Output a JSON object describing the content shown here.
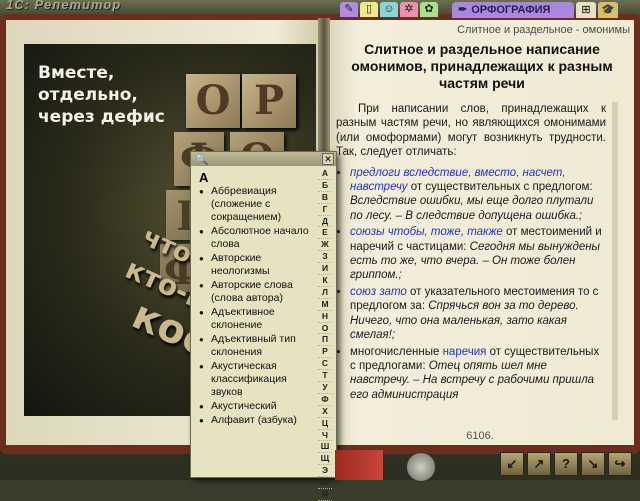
{
  "app": {
    "title": "1C: Репетитор"
  },
  "tabs": {
    "icons": [
      {
        "icon": "book-icon",
        "glyph": "✎",
        "color": "#b28be0"
      },
      {
        "icon": "notebook-icon",
        "glyph": "▯",
        "color": "#f0ea8c"
      },
      {
        "icon": "people-icon",
        "glyph": "☺",
        "color": "#8bd4d8"
      },
      {
        "icon": "sun-icon",
        "glyph": "✲",
        "color": "#f28fb0"
      },
      {
        "icon": "flower-icon",
        "glyph": "✿",
        "color": "#a7e08a"
      }
    ],
    "active_label": "ОРФОГРАФИЯ",
    "end_icon_1": "⊞",
    "end_icon_2": "🎓"
  },
  "cover": {
    "slogan": "Вместе,\nотдельно,\nчерез дефис",
    "blocks": [
      "О",
      "Р",
      "Ф",
      "О",
      "Г",
      "Ф"
    ],
    "slant_lines": [
      "что-либо",
      "кто-нибудь",
      "кое-кто"
    ]
  },
  "right_page": {
    "running_head": "Слитное и раздельное - омонимы",
    "title": "Слитное и раздельное написание омонимов, принадлежащих к разным частям речи",
    "intro": "При написании слов, принадлежащих к разным частям речи, но являющихся омонимами (или омоформами) могут возникнуть трудности. Так, следует отличать:",
    "items": [
      {
        "lead": "предлоги вследствие, вместо, насчет, навстречу",
        "after": " от существительных с предлогом: ",
        "example": "Вследствие ошибки, мы еще долго плутали по лесу. – В следствие допущена ошибка.;"
      },
      {
        "lead": "союзы чтобы, тоже, также",
        "after": " от местоимений и наречий с частицами: ",
        "example": "Сегодня мы вынуждены есть то же, что вчера. – Он тоже болен гриппом.;"
      },
      {
        "lead": "союз зато",
        "after": " от указательного местоимения то с предлогом за: ",
        "example": "Спрячься вон за то дерево. Ничего, что она маленькая, зато какая смелая!;"
      },
      {
        "lead": "",
        "after": "многочисленные ",
        "blue_word": "наречия",
        "after2": " от существительных с предлогами: ",
        "example": "Отец опять шел мне навстречу. – На встречу с рабочими пришла его администрация"
      }
    ],
    "page_number": "6106."
  },
  "index_popup": {
    "letter": "А",
    "entries": [
      "Аббревиация (сложение с сокращением)",
      "Абсолютное начало слова",
      "Авторские неологизмы",
      "Авторские слова (слова автора)",
      "Адъективное склонение",
      "Адъективный тип склонения",
      "Акустическая классификация звуков",
      "Акустический",
      "Алфавит (азбука)"
    ],
    "alphabet": [
      "А",
      "Б",
      "В",
      "Г",
      "Д",
      "Е",
      "Ж",
      "З",
      "И",
      "К",
      "Л",
      "М",
      "Н",
      "О",
      "П",
      "Р",
      "С",
      "Т",
      "У",
      "Ф",
      "Х",
      "Ц",
      "Ч",
      "Ш",
      "Щ",
      "Э",
      "Ю",
      "Я"
    ]
  },
  "nav": {
    "buttons": [
      "↙",
      "↗",
      "?",
      "↘",
      "↪"
    ]
  }
}
